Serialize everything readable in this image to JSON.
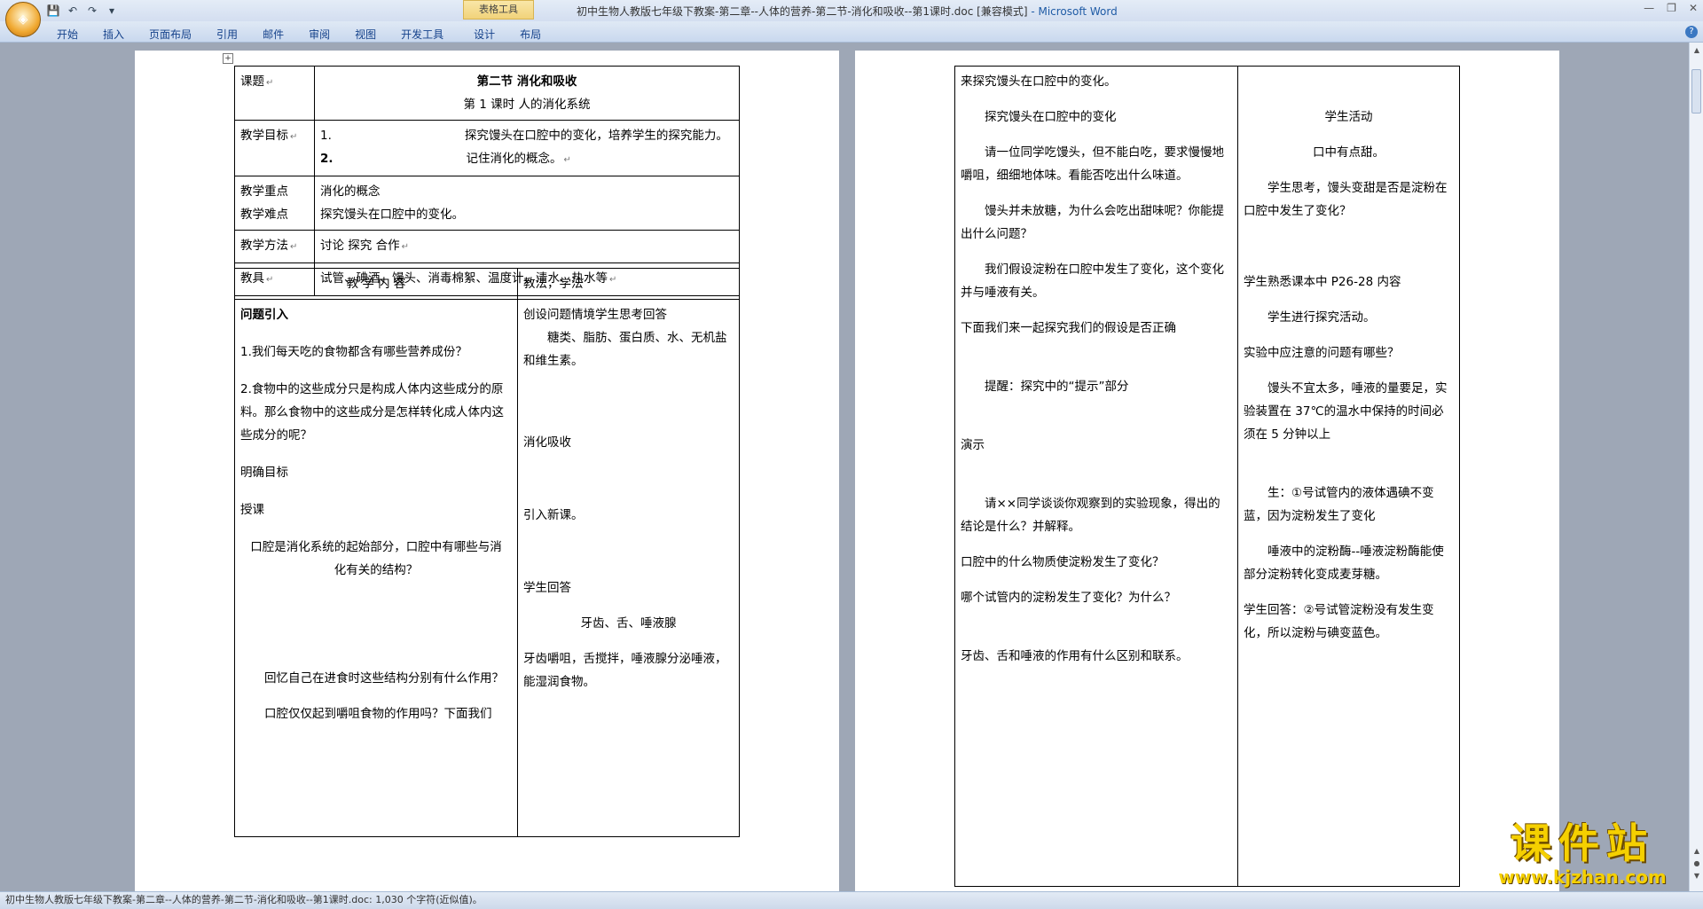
{
  "window": {
    "title": "初中生物人教版七年级下教案-第二章--人体的营养-第二节-消化和吸收--第1课时.doc [兼容模式]",
    "app": " - Microsoft Word",
    "context_tab": "表格工具"
  },
  "ribbon": {
    "tabs": [
      "开始",
      "插入",
      "页面布局",
      "引用",
      "邮件",
      "审阅",
      "视图",
      "开发工具",
      "设计",
      "布局"
    ]
  },
  "status": {
    "text": "初中生物人教版七年级下教案-第二章--人体的营养-第二节-消化和吸收--第1课时.doc: 1,030 个字符(近似值)。"
  },
  "logo": {
    "text": "课件站",
    "url": "www.kjzhan.com"
  },
  "table1": {
    "r1_label": "课题",
    "r1_title": "第二节  消化和吸收",
    "r1_sub": "第 1 课时    人的消化系统",
    "r2_label": "教学目标",
    "r2_n1": "1.",
    "r2_t1": "探究馒头在口腔中的变化，培养学生的探究能力。",
    "r2_n2": "2.",
    "r2_t2": "记住消化的概念。",
    "r3_label1": "教学重点",
    "r3_t1": "消化的概念",
    "r3_label2": "教学难点",
    "r3_t2": "探究馒头在口腔中的变化。",
    "r4_label": "教学方法",
    "r4_t": "讨论     探究      合作",
    "r5_label": "教具",
    "r5_t": "试管、碘酒、馒头、消毒棉絮、温度计、清水、热水等"
  },
  "table2": {
    "h1": "教    学    内    容",
    "h2": "教法，学法",
    "left": [
      "问题引入",
      "1.我们每天吃的食物都含有哪些营养成份？",
      "2.食物中的这些成分只是构成人体内这些成分的原料。那么食物中的这些成分是怎样转化成人体内这些成分的呢？",
      "明确目标",
      "授课",
      "口腔是消化系统的起始部分，口腔中有哪些与消化有关的结构？",
      "回忆自己在进食时这些结构分别有什么作用？",
      "口腔仅仅起到嚼咀食物的作用吗？下面我们"
    ],
    "right": [
      "创设问题情境学生思考回答",
      "糖类、脂肪、蛋白质、水、无机盐和维生素。",
      "消化吸收",
      "引入新课。",
      "学生回答",
      "牙齿、舌、唾液腺",
      "牙齿嚼咀，舌搅拌，唾液腺分泌唾液，能湿润食物。"
    ]
  },
  "table3": {
    "left": [
      "来探究馒头在口腔中的变化。",
      "探究馒头在口腔中的变化",
      "请一位同学吃馒头，但不能白吃，要求慢慢地嚼咀，细细地体味。看能否吃出什么味道。",
      "馒头并未放糖，为什么会吃出甜味呢？你能提出什么问题？",
      "我们假设淀粉在口腔中发生了变化，这个变化并与唾液有关。",
      "下面我们来一起探究我们的假设是否正确",
      "提醒：探究中的“提示”部分",
      "演示",
      "请××同学谈谈你观察到的实验现象，得出的结论是什么？并解释。",
      "口腔中的什么物质使淀粉发生了变化？",
      "哪个试管内的淀粉发生了变化？为什么？",
      "牙齿、舌和唾液的作用有什么区别和联系。"
    ],
    "right": [
      "学生活动",
      "口中有点甜。",
      "学生思考，馒头变甜是否是淀粉在口腔中发生了变化？",
      "学生熟悉课本中 P26-28 内容",
      "学生进行探究活动。",
      "实验中应注意的问题有哪些？",
      "馒头不宜太多，唾液的量要足，实验装置在 37℃的温水中保持的时间必须在 5 分钟以上",
      "生：①号试管内的液体遇碘不变蓝，因为淀粉发生了变化",
      "唾液中的淀粉酶--唾液淀粉酶能使部分淀粉转化变成麦芽糖。",
      "学生回答：②号试管淀粉没有发生变化，所以淀粉与碘变蓝色。"
    ]
  }
}
